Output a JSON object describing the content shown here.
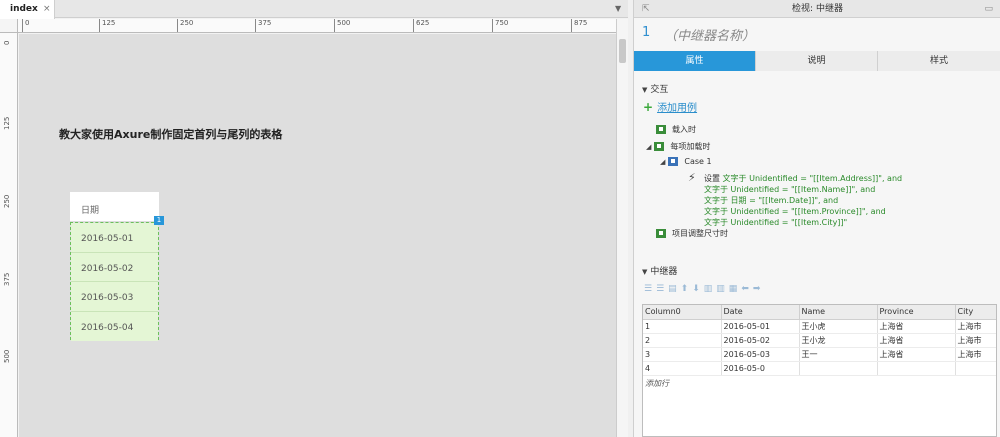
{
  "editor": {
    "tab": "index",
    "tab_close": "×",
    "ruler_h": [
      "0",
      "125",
      "250",
      "375",
      "500",
      "625",
      "750",
      "875"
    ],
    "ruler_v": [
      "0",
      "125",
      "250",
      "375",
      "500"
    ],
    "page_title": "教大家使用Axure制作固定首列与尾列的表格",
    "repeater": {
      "header": "日期",
      "rows": [
        "2016-05-01",
        "2016-05-02",
        "2016-05-03",
        "2016-05-04"
      ],
      "badge": "1"
    }
  },
  "inspector": {
    "title": "检视: 中继器",
    "widget_number": "1",
    "widget_name_placeholder": "（中继器名称）",
    "tabs": [
      "属性",
      "说明",
      "样式"
    ],
    "interaction": {
      "section": "交互",
      "add_case": "添加用例",
      "events": [
        {
          "label": "载入时"
        },
        {
          "label": "每项加载时"
        },
        {
          "label": "Case 1"
        },
        {
          "label": "项目调整尺寸时"
        }
      ],
      "action_prefix": "设置",
      "action_lines": [
        "文字于 Unidentified = \"[[Item.Address]]\", and",
        "文字于 Unidentified = \"[[Item.Name]]\", and",
        "文字于 日期 = \"[[Item.Date]]\", and",
        "文字于 Unidentified = \"[[Item.Province]]\", and",
        "文字于 Unidentified = \"[[Item.City]]\""
      ]
    },
    "repeater_section": {
      "section": "中继器",
      "columns": [
        "Column0",
        "Date",
        "Name",
        "Province",
        "City"
      ],
      "rows": [
        [
          "1",
          "2016-05-01",
          "王小虎",
          "上海省",
          "上海市"
        ],
        [
          "2",
          "2016-05-02",
          "王小龙",
          "上海省",
          "上海市"
        ],
        [
          "3",
          "2016-05-03",
          "王一",
          "上海省",
          "上海市"
        ],
        [
          "4",
          "2016-05-0",
          "",
          "",
          ""
        ]
      ],
      "add_row": "添加行"
    }
  }
}
